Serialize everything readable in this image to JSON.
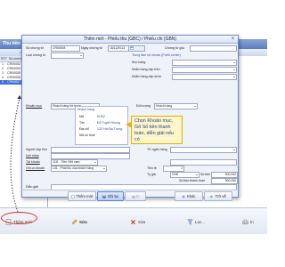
{
  "window": {
    "title": "Thu tiền",
    "toolbar_hint": "Nhấn F3: Tìm kiếm nâng cao"
  },
  "grid": {
    "headers": [
      "STT",
      "Số chứng từ",
      "Ngày"
    ],
    "rows": [
      {
        "stt": "1",
        "so": "CR00002"
      },
      {
        "stt": "2",
        "so": "CR00003"
      },
      {
        "stt": "3",
        "so": "CR00005"
      },
      {
        "stt": "4",
        "so": "CR00006"
      },
      {
        "stt": "5",
        "so": "CR00007"
      }
    ],
    "selected_index": 4
  },
  "bottom": {
    "them_moi": "Thêm mới",
    "sua": "Sửa",
    "xoa": "Xóa",
    "loc": "Lọc...",
    "in": "In"
  },
  "dialog": {
    "title": "Thêm mới - Phiếu thu (GBC) / Phiếu chi (GBN)",
    "so_chung_tu_label": "Số chứng từ",
    "so_chung_tu": "CR00008",
    "ngay_chung_tu_label": "Ngày chứng từ",
    "ngay_chung_tu": "16/12/2013",
    "loai_chung_tu_label": "Loại chứng từ",
    "chung_tu_goc_label": "Chứng từ gốc",
    "tt_section": "Trung tâm lợi nhuận (Profit center)",
    "kho_hang_label": "Kho hàng",
    "nhan_hang_cap1_label": "Nhãn hàng cấp trên",
    "nhan_hang_cap_duoi_label": "Nhãn hàng cấp dưới",
    "khoan_muc_label": "Khoản mục",
    "khoan_muc": "Khách hàng trả trước",
    "doi_tuong_label": "Đối tượng",
    "doi_tuong": "Khách hàng",
    "info": {
      "section": "Khách hàng",
      "ma_label": "Mã",
      "ma": "KH02",
      "ten_label": "Tên",
      "ten": "Đỗ Tuyết Nhung",
      "dia_chi_label": "Địa chỉ",
      "dia_chi": "120 Hai Bà Trưng",
      "ma_so_thue_label": "Mã số thuế"
    },
    "callout": "Chọn Khoản mục, Gõ Số tiền thanh toán, diễn giải nếu có",
    "nguoi_nop_label": "Người nộp tiền",
    "tk_ngan_hang_label": "TK ngân hàng",
    "nh_label": "Nơi nhận",
    "tk_no_label": "Tài khoản",
    "tk_no": "1111 - Tiền Việt nam",
    "ghi_co_label": "Ghi có khoản",
    "ghi_co": "131 - Phải thu của khách hàng",
    "tien_te_label": "Tiền tệ",
    "ty_gia_label": "Tỷ giá",
    "ty_gia": "1",
    "tien_te": "VND",
    "so_tien_label": "Số tiền",
    "so_tien": "500,000",
    "so_tien_hach_toan_label": "Số tiền thanh toán",
    "so_tien_hach_toan": "500,000",
    "dien_giai_label": "Diễn giải",
    "btn_them_moi": "Thêm mới",
    "btn_ghi_lai": "Ghi lại",
    "btn_in": "In",
    "btn_khac": "Khác",
    "btn_tro_ve": "Trở về"
  },
  "colors": {
    "accent": "#3d6fd6",
    "callout_bg": "#fff6c8",
    "highlight_ring": "#e0301e"
  }
}
